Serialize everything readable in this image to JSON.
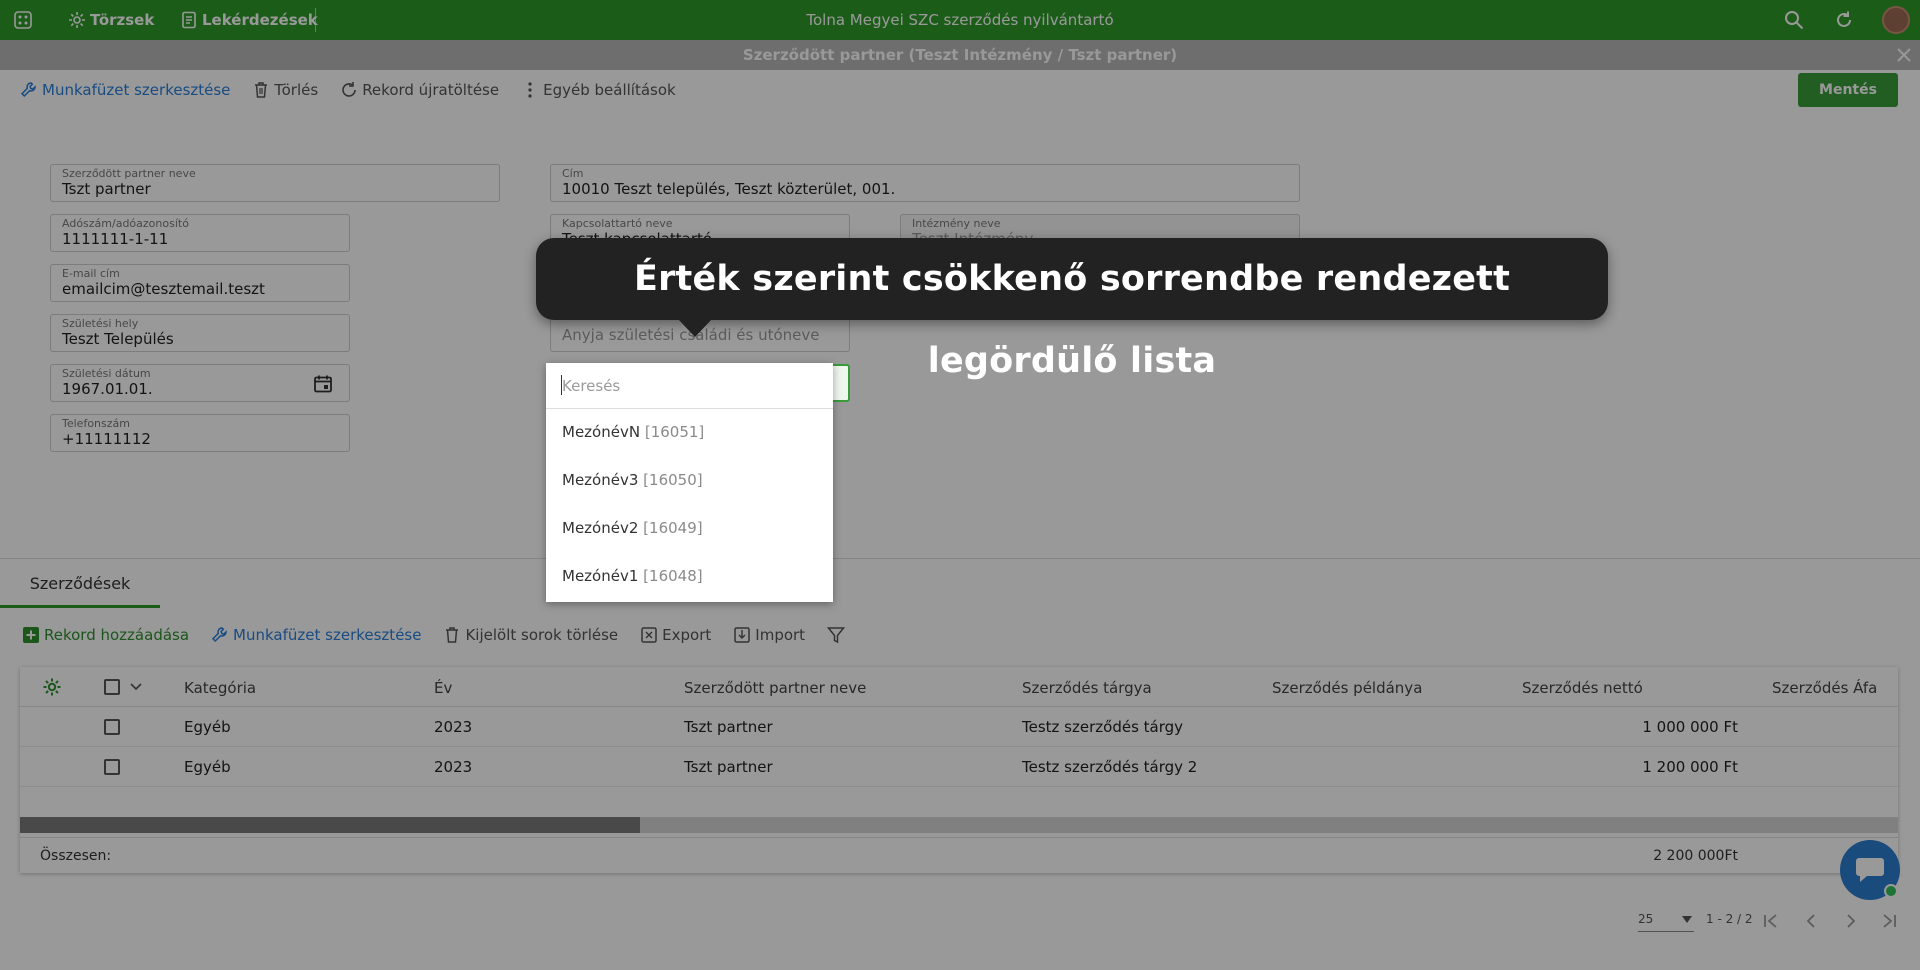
{
  "topbar": {
    "nav_items": [
      {
        "label": "Törzsek",
        "icon": "gear-icon"
      },
      {
        "label": "Lekérdezések",
        "icon": "document-icon"
      }
    ],
    "app_title": "Tolna Megyei SZC szerződés nyilvántartó"
  },
  "window": {
    "title": "Szerződött partner (Teszt Intézmény / Tszt partner)"
  },
  "toolbar": {
    "edit_workbook": "Munkafüzet szerkesztése",
    "delete": "Törlés",
    "reload": "Rekord újratöltése",
    "other_settings": "Egyéb beállítások",
    "save": "Mentés"
  },
  "form": {
    "partner_name": {
      "label": "Szerződött partner neve",
      "value": "Tszt partner"
    },
    "address": {
      "label": "Cím",
      "value": "10010 Teszt település, Teszt közterület, 001."
    },
    "tax_id": {
      "label": "Adószám/adóazonosító",
      "value": "1111111-1-11"
    },
    "contact": {
      "label": "Kapcsolattartó neve",
      "value": "Teszt kapcsolattartó"
    },
    "institution": {
      "label": "Intézmény neve",
      "value": "Teszt Intézmény"
    },
    "email": {
      "label": "E-mail cím",
      "value": "emailcim@tesztemail.teszt"
    },
    "birthplace": {
      "label": "Születési hely",
      "value": "Teszt Település"
    },
    "mother_name": {
      "placeholder": "Anyja születési családi és utóneve"
    },
    "birthdate": {
      "label": "Születési dátum",
      "value": "1967.01.01."
    },
    "phone": {
      "label": "Telefonszám",
      "value": "+11111112"
    }
  },
  "dropdown": {
    "search_placeholder": "Keresés",
    "items": [
      {
        "name": "MezónévN",
        "code": "[16051]"
      },
      {
        "name": "Mezónév3",
        "code": "[16050]"
      },
      {
        "name": "Mezónév2",
        "code": "[16049]"
      },
      {
        "name": "Mezónév1",
        "code": "[16048]"
      }
    ]
  },
  "tooltip": {
    "text": "Érték szerint csökkenő sorrendbe rendezett legördülő lista"
  },
  "tabs": {
    "active": "Szerződések"
  },
  "subtoolbar": {
    "add_record": "Rekord hozzáadása",
    "edit_workbook": "Munkafüzet szerkesztése",
    "delete_selected": "Kijelölt sorok törlése",
    "export": "Export",
    "import": "Import"
  },
  "table": {
    "columns": [
      "Kategória",
      "Év",
      "Szerződött partner neve",
      "Szerződés tárgya",
      "Szerződés példánya",
      "Szerződés nettó",
      "Szerződés Áfa"
    ],
    "rows": [
      {
        "kategoria": "Egyéb",
        "ev": "2023",
        "partner": "Tszt partner",
        "targy": "Testz szerződés tárgy",
        "netto": "1 000 000 Ft"
      },
      {
        "kategoria": "Egyéb",
        "ev": "2023",
        "partner": "Tszt partner",
        "targy": "Testz szerződés tárgy 2",
        "netto": "1 200 000 Ft"
      }
    ],
    "totals_label": "Összesen:",
    "totals_value": "2 200 000Ft",
    "scroll_position": 0.33
  },
  "pager": {
    "page_size": "25",
    "range": "1 - 2 / 2"
  },
  "colors": {
    "brand_green": "#2f9a2a",
    "link_blue": "#2a7fd9",
    "tooltip_bg": "#222222"
  }
}
